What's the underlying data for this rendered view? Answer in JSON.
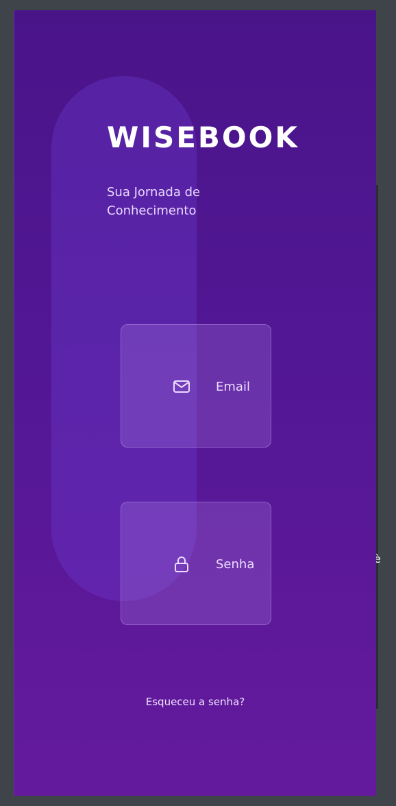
{
  "brand": {
    "title": "WISEBOOK",
    "tagline": "Sua Jornada de Conhecimento"
  },
  "form": {
    "email": {
      "label": "Email",
      "icon": "mail-icon"
    },
    "password": {
      "label": "Senha",
      "icon": "lock-icon"
    }
  },
  "links": {
    "forgot_password": "Esqueceu a senha?"
  },
  "edge": {
    "glyph": "è"
  },
  "colors": {
    "background": "#3f434a",
    "gradient_top": "#4a1489",
    "gradient_bottom": "#651a9d",
    "text_primary": "#ffffff",
    "text_secondary": "#e9d9ff"
  }
}
